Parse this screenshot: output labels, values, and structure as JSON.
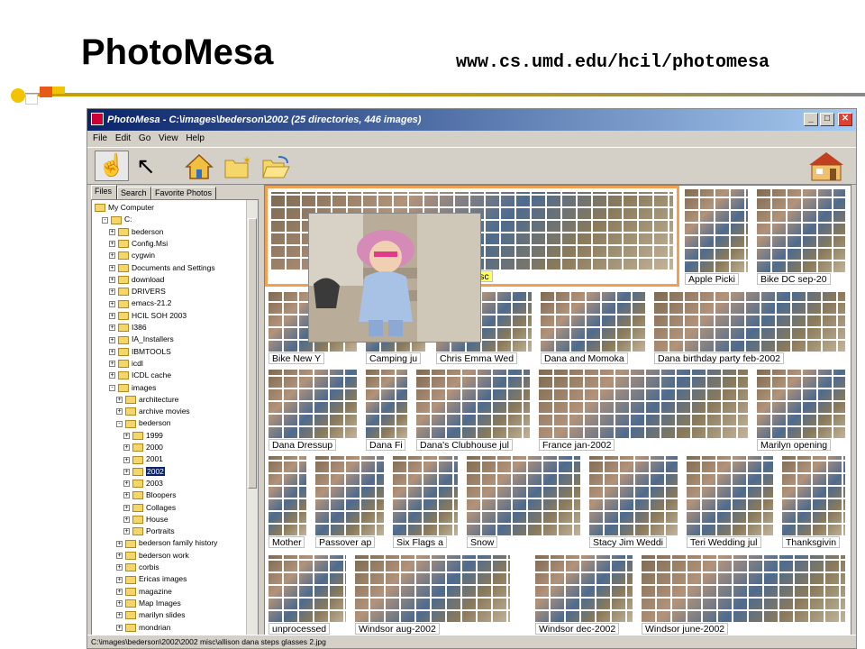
{
  "slide": {
    "title": "PhotoMesa",
    "url": "www.cs.umd.edu/hcil/photomesa"
  },
  "window": {
    "title": "PhotoMesa - C:\\images\\bederson\\2002 (25 directories, 446 images)",
    "minimize": "_",
    "maximize": "□",
    "close": "✕"
  },
  "menu": [
    "File",
    "Edit",
    "Go",
    "View",
    "Help"
  ],
  "toolbar": {
    "icons": [
      "hand-icon",
      "pointer-arrow-icon",
      "home-icon",
      "new-folder-icon",
      "open-folder-icon",
      "house-icon"
    ]
  },
  "left_tabs": [
    "Files",
    "Search",
    "Favorite Photos"
  ],
  "tree": [
    {
      "label": "My Computer",
      "indent": 0,
      "exp": ""
    },
    {
      "label": "C:",
      "indent": 1,
      "exp": "-"
    },
    {
      "label": "bederson",
      "indent": 2,
      "exp": "+"
    },
    {
      "label": "Config.Msi",
      "indent": 2,
      "exp": "+"
    },
    {
      "label": "cygwin",
      "indent": 2,
      "exp": "+"
    },
    {
      "label": "Documents and Settings",
      "indent": 2,
      "exp": "+"
    },
    {
      "label": "download",
      "indent": 2,
      "exp": "+"
    },
    {
      "label": "DRIVERS",
      "indent": 2,
      "exp": "+"
    },
    {
      "label": "emacs-21.2",
      "indent": 2,
      "exp": "+"
    },
    {
      "label": "HCIL SOH 2003",
      "indent": 2,
      "exp": "+"
    },
    {
      "label": "I386",
      "indent": 2,
      "exp": "+"
    },
    {
      "label": "IA_Installers",
      "indent": 2,
      "exp": "+"
    },
    {
      "label": "IBMTOOLS",
      "indent": 2,
      "exp": "+"
    },
    {
      "label": "icdl",
      "indent": 2,
      "exp": "+"
    },
    {
      "label": "ICDL cache",
      "indent": 2,
      "exp": "+"
    },
    {
      "label": "images",
      "indent": 2,
      "exp": "-"
    },
    {
      "label": "architecture",
      "indent": 3,
      "exp": "+"
    },
    {
      "label": "archive movies",
      "indent": 3,
      "exp": "+"
    },
    {
      "label": "bederson",
      "indent": 3,
      "exp": "-"
    },
    {
      "label": "1999",
      "indent": 4,
      "exp": "+"
    },
    {
      "label": "2000",
      "indent": 4,
      "exp": "+"
    },
    {
      "label": "2001",
      "indent": 4,
      "exp": "+"
    },
    {
      "label": "2002",
      "indent": 4,
      "exp": "+",
      "selected": true
    },
    {
      "label": "2003",
      "indent": 4,
      "exp": "+"
    },
    {
      "label": "Bloopers",
      "indent": 4,
      "exp": "+"
    },
    {
      "label": "Collages",
      "indent": 4,
      "exp": "+"
    },
    {
      "label": "House",
      "indent": 4,
      "exp": "+"
    },
    {
      "label": "Portraits",
      "indent": 4,
      "exp": "+"
    },
    {
      "label": "bederson family history",
      "indent": 3,
      "exp": "+"
    },
    {
      "label": "bederson work",
      "indent": 3,
      "exp": "+"
    },
    {
      "label": "corbis",
      "indent": 3,
      "exp": "+"
    },
    {
      "label": "Ericas images",
      "indent": 3,
      "exp": "+"
    },
    {
      "label": "magazine",
      "indent": 3,
      "exp": "+"
    },
    {
      "label": "Map Images",
      "indent": 3,
      "exp": "+"
    },
    {
      "label": "marilyn slides",
      "indent": 3,
      "exp": "+"
    },
    {
      "label": "mondrian",
      "indent": 3,
      "exp": "+"
    }
  ],
  "groups": [
    {
      "label": "misc",
      "highlight": true
    },
    {
      "label": "Apple Picki"
    },
    {
      "label": "Bike DC sep-20"
    },
    {
      "label": "Bike New Y"
    },
    {
      "label": "Camping ju"
    },
    {
      "label": "Chris Emma Wed"
    },
    {
      "label": "Dana and Momoka"
    },
    {
      "label": "Dana birthday party feb-2002"
    },
    {
      "label": "Dana Dressup"
    },
    {
      "label": "Dana Fi"
    },
    {
      "label": "Dana's Clubhouse jul"
    },
    {
      "label": "France jan-2002"
    },
    {
      "label": "Marilyn opening"
    },
    {
      "label": "Mother"
    },
    {
      "label": "Passover ap"
    },
    {
      "label": "Six Flags a"
    },
    {
      "label": "Snow"
    },
    {
      "label": "Stacy Jim Weddi"
    },
    {
      "label": "Teri Wedding jul"
    },
    {
      "label": "Thanksgivin"
    },
    {
      "label": "unprocessed"
    },
    {
      "label": "Windsor aug-2002"
    },
    {
      "label": "Windsor dec-2002"
    },
    {
      "label": "Windsor june-2002"
    }
  ],
  "status": "C:\\images\\bederson\\2002\\2002 misc\\allison dana steps glasses 2.jpg"
}
